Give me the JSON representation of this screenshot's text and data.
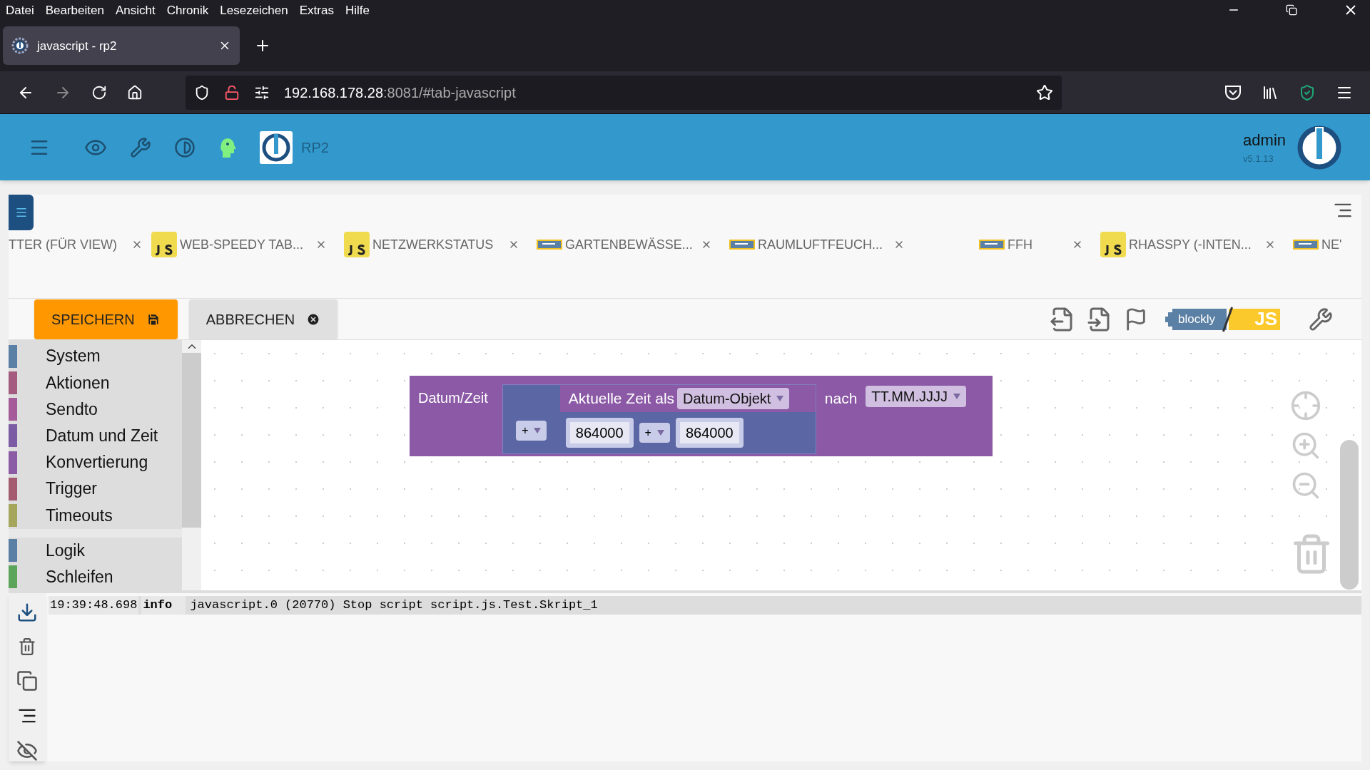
{
  "menu_bar": [
    "Datei",
    "Bearbeiten",
    "Ansicht",
    "Chronik",
    "Lesezeichen",
    "Extras",
    "Hilfe"
  ],
  "browser_tab": {
    "title": "javascript - rp2",
    "selected": true
  },
  "address_bar": {
    "host": "192.168.178.28",
    "rest": ":8081/#tab-javascript"
  },
  "header": {
    "instance": "RP2",
    "user": "admin",
    "version": "v5.1.13"
  },
  "script_tabs": [
    {
      "label": "TTER (FÜR VIEW)",
      "kind": "none",
      "closable": true
    },
    {
      "label": "WEB-SPEEDY TAB...",
      "kind": "js",
      "closable": true
    },
    {
      "label": "NETZWERKSTATUS",
      "kind": "js",
      "closable": true
    },
    {
      "label": "GARTENBEWÄSSE...",
      "kind": "blockly",
      "closable": true
    },
    {
      "label": "RAUMLUFTFEUCH...",
      "kind": "blockly",
      "closable": true
    },
    {
      "label": "FFH",
      "kind": "blockly",
      "closable": true
    },
    {
      "label": "RHASSPY (-INTEN...",
      "kind": "js",
      "closable": true
    },
    {
      "label": "NE'",
      "kind": "blockly",
      "closable": false
    }
  ],
  "toolbar": {
    "save": "SPEICHERN",
    "cancel": "ABBRECHEN",
    "blockly_badge": "blockly",
    "js_badge": "JS"
  },
  "categories": [
    {
      "label": "System",
      "color": "#5b80a5",
      "separated": false
    },
    {
      "label": "Aktionen",
      "color": "#a55b80",
      "separated": false
    },
    {
      "label": "Sendto",
      "color": "#a55b99",
      "separated": false
    },
    {
      "label": "Datum und Zeit",
      "color": "#7c5ba5",
      "separated": false
    },
    {
      "label": "Konvertierung",
      "color": "#8c5ba5",
      "separated": false
    },
    {
      "label": "Trigger",
      "color": "#a55b6f",
      "separated": false
    },
    {
      "label": "Timeouts",
      "color": "#a5a55b",
      "separated": false
    },
    {
      "label": "Logik",
      "color": "#5b80a5",
      "separated": true
    },
    {
      "label": "Schleifen",
      "color": "#5ba55b",
      "separated": false
    }
  ],
  "block": {
    "label": "Datum/Zeit",
    "operator": "+",
    "now_label": "Aktuelle Zeit als",
    "now_format": "Datum-Objekt",
    "value_a": "864000",
    "inner_operator": "+",
    "value_b": "864000",
    "to_label": "nach",
    "target_format": "TT.MM.JJJJ"
  },
  "log": [
    {
      "time": "19:39:48.698",
      "level": "info",
      "message": "javascript.0 (20770) Stop script script.js.Test.Skript_1"
    }
  ]
}
